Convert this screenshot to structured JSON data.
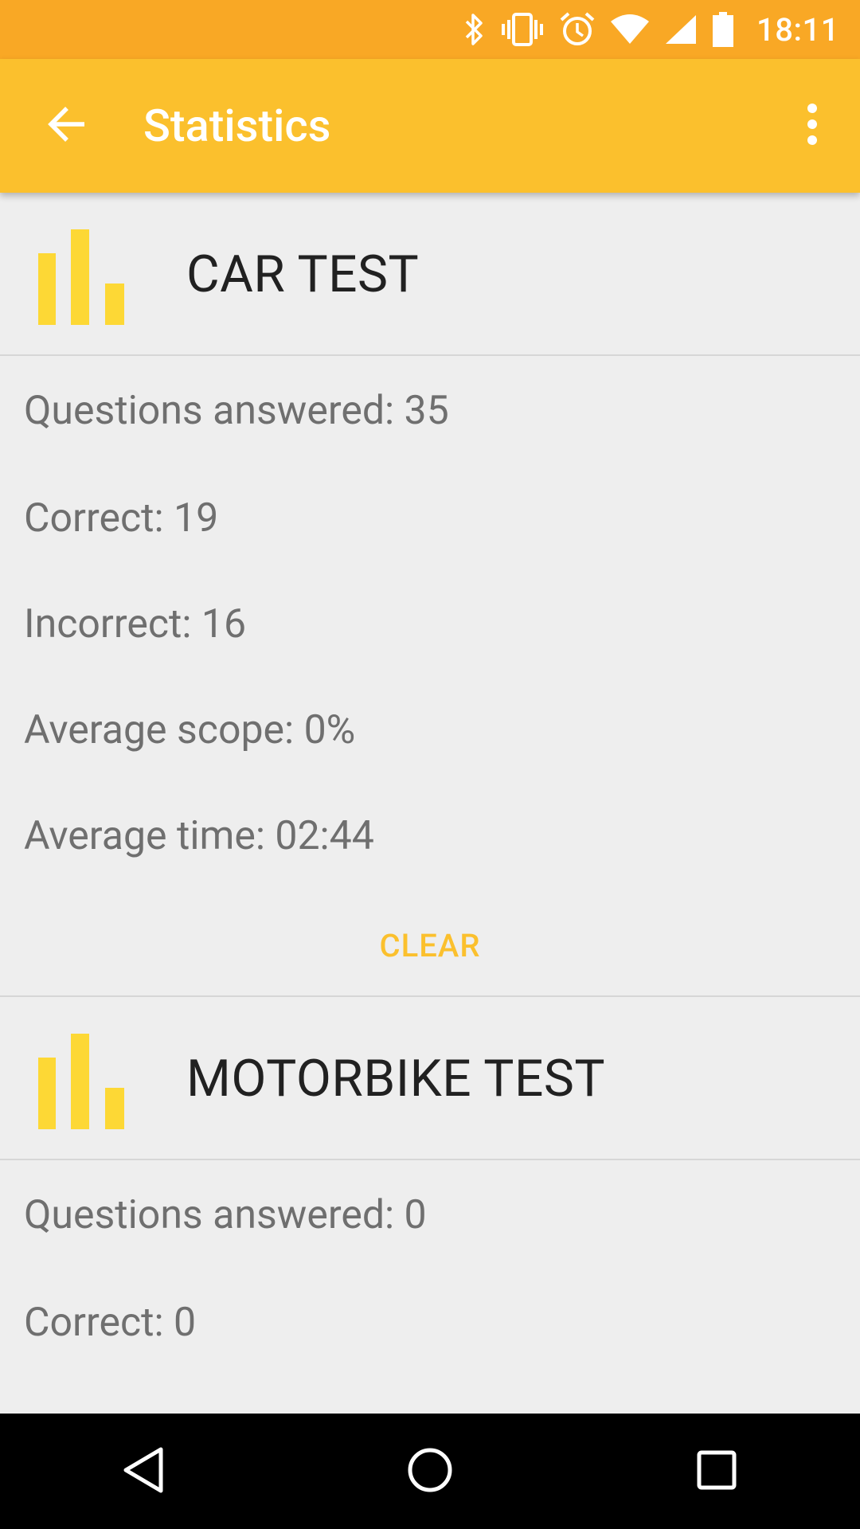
{
  "status_bar": {
    "time": "18:11",
    "icons": [
      "bluetooth-icon",
      "vibrate-icon",
      "alarm-icon",
      "wifi-icon",
      "signal-icon",
      "battery-icon"
    ]
  },
  "app_bar": {
    "title": "Statistics",
    "back_icon": "arrow-back-icon",
    "menu_icon": "more-vert-icon"
  },
  "colors": {
    "status_bar": "#f9a825",
    "app_bar": "#fbc02d",
    "accent": "#fbc02d",
    "chart_icon": "#fdd835"
  },
  "sections": [
    {
      "title": "CAR TEST",
      "stats": [
        "Questions answered: 35",
        "Correct: 19",
        "Incorrect: 16",
        "Average scope: 0%",
        "Average time: 02:44"
      ],
      "clear_label": "CLEAR"
    },
    {
      "title": "MOTORBIKE TEST",
      "stats": [
        "Questions answered: 0",
        "Correct: 0"
      ]
    }
  ],
  "nav_bar": {
    "icons": [
      "nav-back-icon",
      "nav-home-icon",
      "nav-recents-icon"
    ]
  }
}
